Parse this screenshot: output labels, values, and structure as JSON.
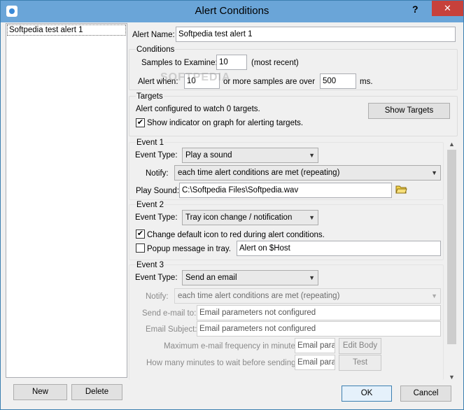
{
  "window": {
    "title": "Alert Conditions",
    "help": "?",
    "close": "✕"
  },
  "alert_list": {
    "items": [
      "Softpedia test alert 1"
    ]
  },
  "left_buttons": {
    "new": "New",
    "delete": "Delete"
  },
  "alert_name": {
    "label": "Alert Name:",
    "value": "Softpedia test alert 1"
  },
  "conditions": {
    "heading": "Conditions",
    "samples_label": "Samples to Examine:",
    "samples_value": "10",
    "samples_suffix": "(most recent)",
    "alert_when_label": "Alert when:",
    "alert_when_value": "10",
    "over_label": "or more samples are over",
    "threshold_value": "500",
    "unit": "ms."
  },
  "targets": {
    "heading": "Targets",
    "status": "Alert configured to watch 0 targets.",
    "show_button": "Show Targets",
    "indicator_label": "Show indicator on graph for alerting targets.",
    "indicator_checked": true
  },
  "event1": {
    "heading": "Event 1",
    "type_label": "Event Type:",
    "type_value": "Play a sound",
    "notify_label": "Notify:",
    "notify_value": "each time alert conditions are met (repeating)",
    "sound_label": "Play Sound:",
    "sound_value": "C:\\Softpedia Files\\Softpedia.wav",
    "folder_icon": "folder-icon"
  },
  "event2": {
    "heading": "Event 2",
    "type_label": "Event Type:",
    "type_value": "Tray icon change / notification",
    "change_icon_label": "Change default icon to red during alert conditions.",
    "change_icon_checked": true,
    "popup_label": "Popup message in tray.",
    "popup_checked": false,
    "popup_value": "Alert on $Host"
  },
  "event3": {
    "heading": "Event 3",
    "type_label": "Event Type:",
    "type_value": "Send an email",
    "notify_label": "Notify:",
    "notify_value": "each time alert conditions are met (repeating)",
    "send_to_label": "Send e-mail to:",
    "send_to_value": "Email parameters not configured",
    "subject_label": "Email Subject:",
    "subject_value": "Email parameters not configured",
    "max_freq_label": "Maximum e-mail frequency in minutes:",
    "max_freq_value": "Email param",
    "edit_body": "Edit Body",
    "wait_label": "How many minutes to wait before sending:",
    "wait_value": "Email param",
    "test": "Test"
  },
  "footer": {
    "ok": "OK",
    "cancel": "Cancel"
  },
  "watermark": "SOFTPEDIA"
}
